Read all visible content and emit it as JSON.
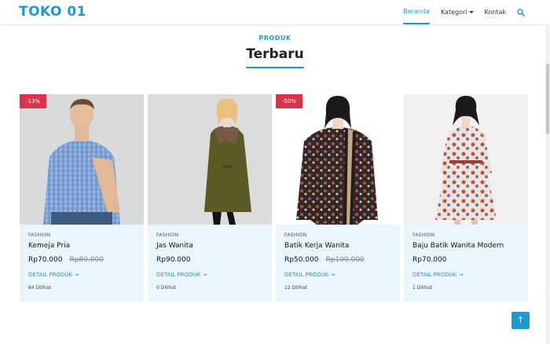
{
  "navbar": {
    "brand": "TOKO 01",
    "items": [
      {
        "label": "Beranda",
        "active": true
      },
      {
        "label": "Kategori",
        "dropdown": true
      },
      {
        "label": "Kontak"
      }
    ],
    "search_icon": "search-icon"
  },
  "section": {
    "label": "PRODUK",
    "title": "Terbaru"
  },
  "products": [
    {
      "badge": "-13%",
      "category": "FASHION",
      "name": "Kemeja Pria",
      "price": "Rp70.000",
      "old_price": "Rp80.000",
      "detail": "DETAIL PRODUK →",
      "views": "84 Dilihat"
    },
    {
      "badge": "",
      "category": "FASHION",
      "name": "Jas Wanita",
      "price": "Rp90.000",
      "old_price": "",
      "detail": "DETAIL PRODUK →",
      "views": "0 Dilihat"
    },
    {
      "badge": "-50%",
      "category": "FASHION",
      "name": "Batik Kerja Wanita",
      "price": "Rp50.000",
      "old_price": "Rp100.000",
      "detail": "DETAIL PRODUK →",
      "views": "12 Dilihat"
    },
    {
      "badge": "",
      "category": "FASHION",
      "name": "Baju Batik Wanita Modern",
      "price": "Rp70.000",
      "old_price": "",
      "detail": "DETAIL PRODUK →",
      "views": "1 Dilihat"
    }
  ],
  "back_to_top": "↑",
  "colors": {
    "accent": "#1a9ad6",
    "badge": "#e0314a",
    "card_bg": "#eaf6fd"
  }
}
